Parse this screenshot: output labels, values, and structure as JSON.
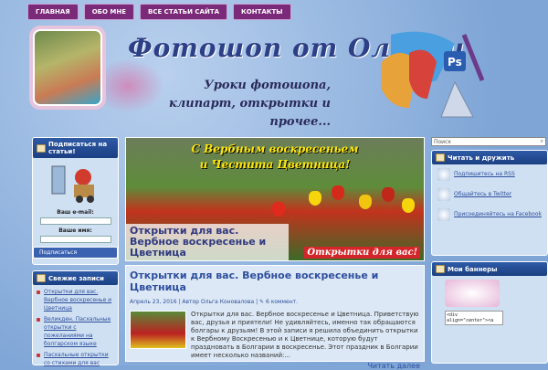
{
  "nav": [
    "ГЛАВНАЯ",
    "ОБО МНЕ",
    "ВСЕ СТАТЬИ САЙТА",
    "КОНТАКТЫ"
  ],
  "header": {
    "title": "Фотошоп от Олечки",
    "tagline": "Уроки фотошопа, клипарт, открытки и прочее..."
  },
  "sidebar_left": {
    "subscribe_title": "Подписаться на статьи!",
    "email_label": "Ваш e-mail:",
    "name_label": "Ваше имя:",
    "submit_label": "Подписаться",
    "recent_title": "Свежие записи",
    "recent_items": [
      "Открытки для вас. Вербное воскресенье и Цветница",
      "Великден. Пасхальные открытки с пожеланиями на болгарском языке",
      "Пасхальные открытки со стихами для вас"
    ]
  },
  "slider": {
    "banner_line1": "С Вербным воскресеньем",
    "banner_line2": "и Честита Цветница!",
    "caption": "Открытки для вас. Вербное воскресенье и Цветница",
    "stamp": "Открытки для вас!"
  },
  "post": {
    "title": "Открытки для вас. Вербное воскресенье и Цветница",
    "date": "Апрель 23, 2016",
    "author": "Автор Ольга Коновалова",
    "comments": "6 коммент.",
    "excerpt": "Открытки для вас. Вербное воскресенье и Цветница. Приветствую вас, друзья и приятели! Не удивляйтесь, именно так обращаются болгары к друзьям! В этой записи я решила объединить открытки к Вербному Воскресенью и к Цветнице, которую будут праздновать в Болгарии в воскресенье. Этот праздник в Болгарии имеет несколько названий:...",
    "more": "Читать далее"
  },
  "sidebar_right": {
    "search_placeholder": "Поиск",
    "social_title": "Читать и дружить",
    "social_items": [
      "Подпишитесь на RSS",
      "Общайтесь в Twitter",
      "Присоединяйтесь на Facebook"
    ],
    "banners_title": "Мои баннеры",
    "banner_code": "<div align=\"center\"><a"
  }
}
